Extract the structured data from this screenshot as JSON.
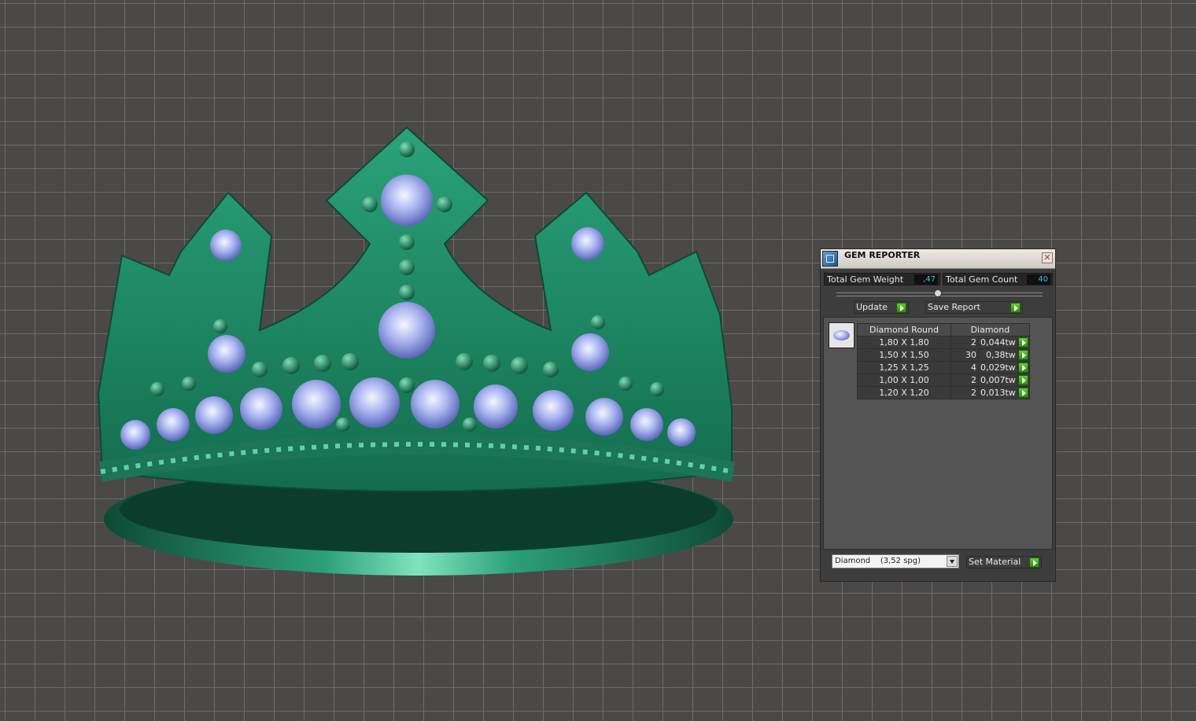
{
  "panel": {
    "title": "GEM REPORTER",
    "close_symbol": "✕",
    "total_weight_label": "Total Gem Weight",
    "total_weight_value": ",47",
    "total_count_label": "Total Gem Count",
    "total_count_value": "40",
    "update_label": "Update",
    "save_report_label": "Save Report",
    "table": {
      "headers": [
        "Diamond Round",
        "Diamond"
      ],
      "rows": [
        {
          "size": "1,80 X 1,80",
          "count": "2",
          "weight": "0,044tw"
        },
        {
          "size": "1,50 X 1,50",
          "count": "30",
          "weight": "0,38tw"
        },
        {
          "size": "1,25 X 1,25",
          "count": "4",
          "weight": "0,029tw"
        },
        {
          "size": "1,00 X 1,00",
          "count": "2",
          "weight": "0,007tw"
        },
        {
          "size": "1,20 X 1,20",
          "count": "2",
          "weight": "0,013tw"
        }
      ]
    },
    "material_select": "Diamond    (3,52 spg)",
    "set_material_label": "Set Material"
  },
  "colors": {
    "viewport_bg": "#4b4848",
    "grid_line": "#6f6b6b",
    "crown_green": "#1f8a63",
    "gem_blue": "#a9b4f0",
    "value_cyan": "#3fc4e8",
    "play_green": "#3fa51c"
  },
  "icons": [
    "gem-reporter-icon",
    "close-icon",
    "play-icon",
    "gem-thumbnail-icon",
    "chevron-down-icon"
  ]
}
